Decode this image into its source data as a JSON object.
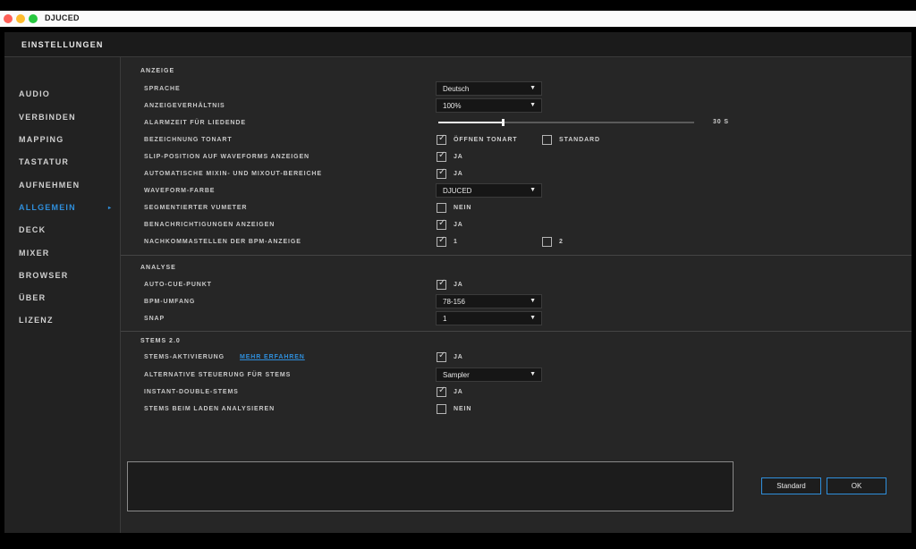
{
  "app": {
    "title": "DJUCED"
  },
  "dialog": {
    "title": "EINSTELLUNGEN"
  },
  "sidebar": {
    "items": [
      {
        "label": "AUDIO"
      },
      {
        "label": "VERBINDEN"
      },
      {
        "label": "MAPPING"
      },
      {
        "label": "TASTATUR"
      },
      {
        "label": "AUFNEHMEN"
      },
      {
        "label": "ALLGEMEIN",
        "active": true
      },
      {
        "label": "DECK"
      },
      {
        "label": "MIXER"
      },
      {
        "label": "BROWSER"
      },
      {
        "label": "ÜBER"
      },
      {
        "label": "LIZENZ"
      }
    ]
  },
  "anzeige": {
    "heading": "ANZEIGE",
    "sprache": {
      "label": "SPRACHE",
      "value": "Deutsch"
    },
    "verhaeltnis": {
      "label": "ANZEIGEVERHÄLTNIS",
      "value": "100%"
    },
    "alarmzeit": {
      "label": "ALARMZEIT FÜR LIEDENDE",
      "value": "30 S",
      "level": 0.25
    },
    "tonart": {
      "label": "BEZEICHNUNG TONART",
      "opt1": "ÖFFNEN TONART",
      "opt2": "STANDARD"
    },
    "slip": {
      "label": "SLIP-POSITION AUF WAVEFORMS ANZEIGEN",
      "value": "JA"
    },
    "mixin": {
      "label": "AUTOMATISCHE MIXIN- UND MIXOUT-BEREICHE",
      "value": "JA"
    },
    "waveform": {
      "label": "WAVEFORM-FARBE",
      "value": "DJUCED"
    },
    "vumeter": {
      "label": "SEGMENTIERTER VUMETER",
      "value": "NEIN"
    },
    "benachrichtigungen": {
      "label": "BENACHRICHTIGUNGEN ANZEIGEN",
      "value": "JA"
    },
    "nachkomma": {
      "label": "NACHKOMMASTELLEN DER BPM-ANZEIGE",
      "opt1": "1",
      "opt2": "2"
    }
  },
  "analyse": {
    "heading": "ANALYSE",
    "autocue": {
      "label": "AUTO-CUE-PUNKT",
      "value": "JA"
    },
    "bpm": {
      "label": "BPM-UMFANG",
      "value": "78-156"
    },
    "snap": {
      "label": "SNAP",
      "value": "1"
    }
  },
  "stems": {
    "heading": "STEMS 2.0",
    "aktivierung": {
      "label": "STEMS-AKTIVIERUNG",
      "link": "MEHR ERFAHREN",
      "value": "JA"
    },
    "alternative": {
      "label": "ALTERNATIVE STEUERUNG FÜR STEMS",
      "value": "Sampler"
    },
    "instant": {
      "label": "INSTANT-DOUBLE-STEMS",
      "value": "JA"
    },
    "laden": {
      "label": "STEMS BEIM LADEN ANALYSIEREN",
      "value": "NEIN"
    }
  },
  "buttons": {
    "standard": "Standard",
    "ok": "OK"
  },
  "icons": {
    "checkbox_tick": "✓",
    "caret": "▼",
    "active_arrow": "▸"
  },
  "colors": {
    "accent": "#2f8fdc",
    "background": "#262626"
  }
}
